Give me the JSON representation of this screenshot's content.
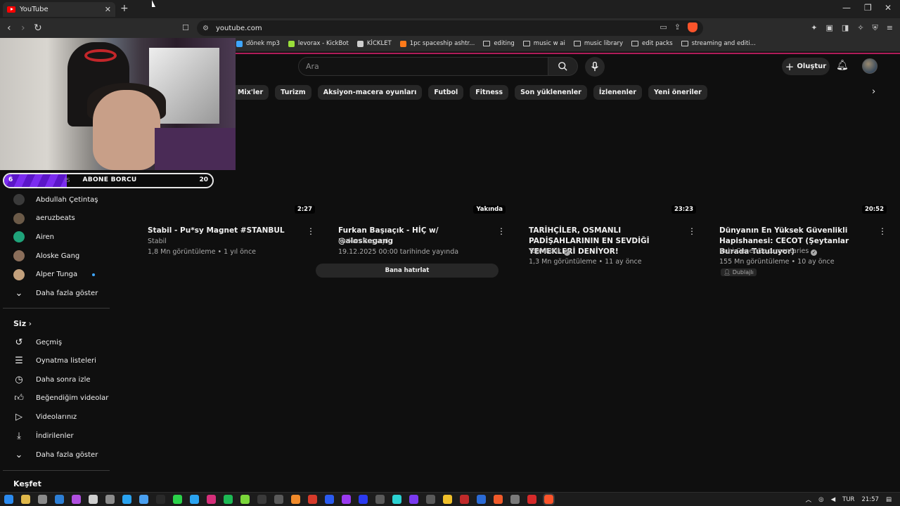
{
  "browser": {
    "tab_title": "YouTube",
    "url": "youtube.com",
    "new_tab_label": "+",
    "bookmarks": [
      {
        "label": "dönek mp3",
        "color": "#3ea6ff"
      },
      {
        "label": "levorax - KickBot",
        "color": "#9adf3a"
      },
      {
        "label": "KİCKLET",
        "color": "#cfcfcf"
      },
      {
        "label": "1pc spaceship ashtr...",
        "color": "#ff7a1a"
      },
      {
        "label": "editing",
        "color": ""
      },
      {
        "label": "music w ai",
        "color": ""
      },
      {
        "label": "music library",
        "color": ""
      },
      {
        "label": "edit packs",
        "color": ""
      },
      {
        "label": "streaming and editi...",
        "color": ""
      }
    ]
  },
  "header": {
    "search_placeholder": "Ara",
    "create_label": "Oluştur"
  },
  "chips": [
    "Mix'ler",
    "Turizm",
    "Aksiyon-macera oyunları",
    "Futbol",
    "Fitness",
    "Son yüklenenler",
    "İzlenenler",
    "Yeni öneriler"
  ],
  "overlay": {
    "sub_goal": {
      "left_value": "6",
      "suffix": "IS",
      "title": "ABONE BORCU",
      "right_value": "20",
      "progress": 0.3
    }
  },
  "sidebar": {
    "subscriptions": [
      {
        "label": "Abdullah Çetintaş",
        "avatar_color": "#3a3a3a",
        "live_dot": false
      },
      {
        "label": "aeruzbeats",
        "avatar_color": "#6b5a48",
        "live_dot": false
      },
      {
        "label": "Airen",
        "avatar_color": "#1fa37a",
        "live_dot": false
      },
      {
        "label": "Aloske Gang",
        "avatar_color": "#8a6e5a",
        "live_dot": false
      },
      {
        "label": "Alper Tunga",
        "avatar_color": "#c2a07c",
        "live_dot": true
      }
    ],
    "show_more_1": "Daha fazla göster",
    "you_section": "Siz",
    "you_items": [
      {
        "label": "Geçmiş",
        "icon": "history-icon"
      },
      {
        "label": "Oynatma listeleri",
        "icon": "playlists-icon"
      },
      {
        "label": "Daha sonra izle",
        "icon": "watch-later-icon"
      },
      {
        "label": "Beğendiğim videolar",
        "icon": "liked-icon"
      },
      {
        "label": "Videolarınız",
        "icon": "your-videos-icon"
      },
      {
        "label": "İndirilenler",
        "icon": "downloads-icon"
      }
    ],
    "show_more_2": "Daha fazla göster",
    "explore_section": "Keşfet"
  },
  "videos": [
    {
      "duration": "2:27",
      "title": "Stabil - Pu*sy Magnet #STANBUL",
      "channel": "Stabil",
      "verified": false,
      "meta": "1,8 Mn görüntüleme • 1 yıl önce"
    },
    {
      "duration": "Yakında",
      "title": "Furkan Başıaçık - HİÇ  w/ @aloskegang",
      "channel": "Furkan Başıaçık",
      "verified": false,
      "meta": "19.12.2025 00:00 tarihinde yayında",
      "button": "Bana hatırlat"
    },
    {
      "duration": "23:23",
      "title": "TARİHÇİLER, OSMANLI PADİŞAHLARININ EN SEVDİĞİ YEMEKLERİ DENİYOR!",
      "channel": "TepkiKolik",
      "verified": true,
      "meta": "1,3 Mn görüntüleme • 11 ay önce"
    },
    {
      "duration": "20:52",
      "title": "Dünyanın En Yüksek Güvenlikli Hapishanesi: CECOT (Şeytanlar Burada Tutuluyor)",
      "channel": "Ruhi Cenet Documentaries",
      "verified": true,
      "meta": "155 Mn görüntüleme • 10 ay önce",
      "badge": "Dublajlı"
    }
  ],
  "taskbar": {
    "lang": "TUR",
    "time": "21:57"
  }
}
